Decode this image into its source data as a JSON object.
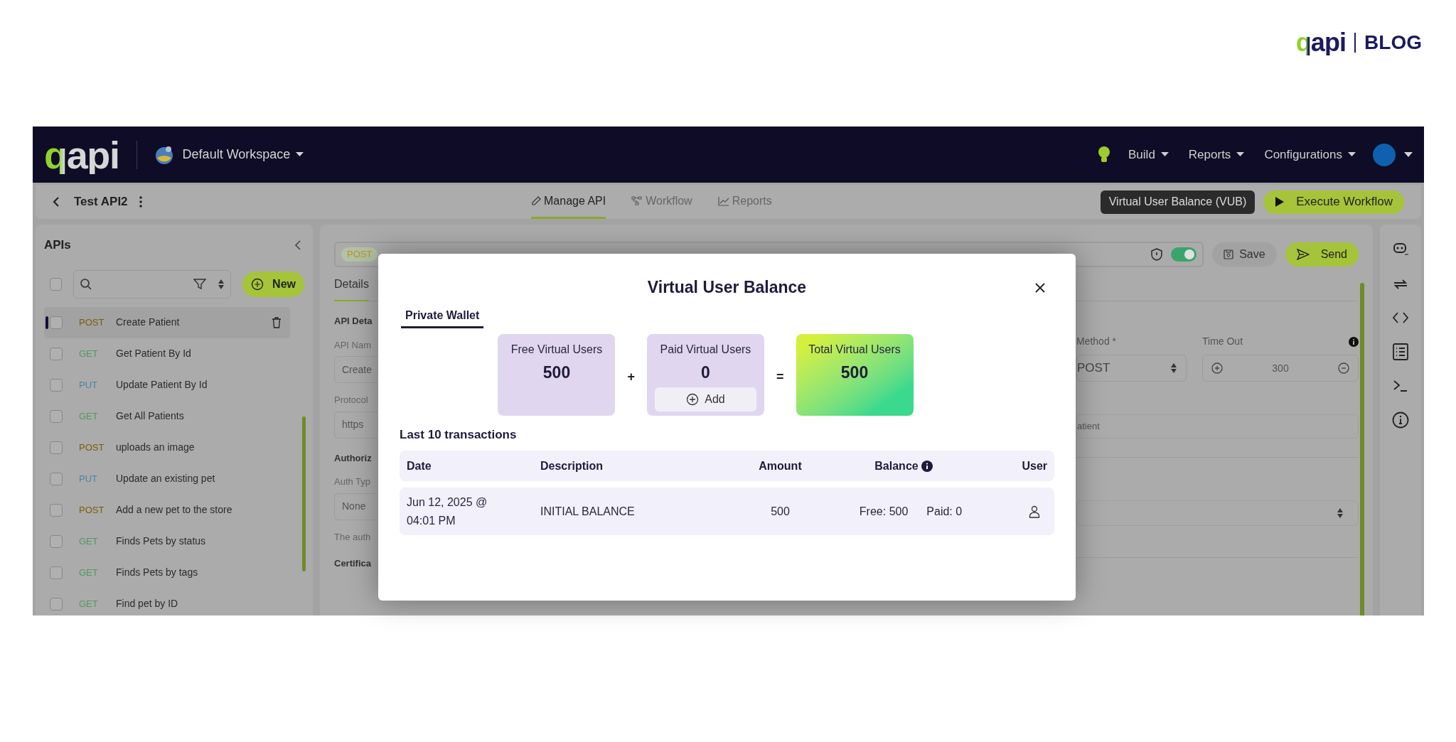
{
  "blog_brand": {
    "logo": "qapi",
    "label": "BLOG"
  },
  "header": {
    "logo": "qapi",
    "workspace": "Default Workspace",
    "menus": [
      "Build",
      "Reports",
      "Configurations"
    ]
  },
  "subheader": {
    "project": "Test API2",
    "tabs": [
      {
        "label": "Manage API",
        "kind": "pencil",
        "selected": true
      },
      {
        "label": "Workflow",
        "kind": "nodes",
        "selected": false
      },
      {
        "label": "Reports",
        "kind": "chart",
        "selected": false
      }
    ],
    "vub_button": "Virtual User Balance (VUB)",
    "execute_button": "Execute Workflow"
  },
  "sidebar": {
    "title": "APIs",
    "select_all": {
      "checked": false
    },
    "new_button": "New",
    "items": [
      {
        "method": "POST",
        "color": "#7a5c08",
        "name": "Create Patient",
        "selected": true,
        "checked": false
      },
      {
        "method": "GET",
        "color": "#4f9a5c",
        "name": "Get Patient By Id",
        "selected": false,
        "checked": false
      },
      {
        "method": "PUT",
        "color": "#4b84a6",
        "name": "Update Patient By Id",
        "selected": false,
        "checked": false
      },
      {
        "method": "GET",
        "color": "#4f9a5c",
        "name": "Get All Patients",
        "selected": false,
        "checked": false
      },
      {
        "method": "POST",
        "color": "#7a5c08",
        "name": "uploads an image",
        "selected": false,
        "checked": false
      },
      {
        "method": "PUT",
        "color": "#4b84a6",
        "name": "Update an existing pet",
        "selected": false,
        "checked": false
      },
      {
        "method": "POST",
        "color": "#7a5c08",
        "name": "Add a new pet to the store",
        "selected": false,
        "checked": false
      },
      {
        "method": "GET",
        "color": "#4f9a5c",
        "name": "Finds Pets by status",
        "selected": false,
        "checked": false
      },
      {
        "method": "GET",
        "color": "#4f9a5c",
        "name": "Finds Pets by tags",
        "selected": false,
        "checked": false
      },
      {
        "method": "GET",
        "color": "#4f9a5c",
        "name": "Find pet by ID",
        "selected": false,
        "checked": false
      }
    ]
  },
  "editor": {
    "method_badge": "POST",
    "secure_toggle": {
      "on": true
    },
    "save_button": "Save",
    "send_button": "Send",
    "tab": "Details",
    "left_fragments": [
      {
        "kind": "heading",
        "text": "API Deta"
      },
      {
        "kind": "label",
        "text": "API Nam"
      },
      {
        "kind": "field",
        "text": "Create"
      },
      {
        "kind": "label",
        "text": "Protocol"
      },
      {
        "kind": "field",
        "text": "https"
      },
      {
        "kind": "heading",
        "text": "Authoriz"
      },
      {
        "kind": "label",
        "text": "Auth Typ"
      },
      {
        "kind": "field",
        "text": "None"
      },
      {
        "kind": "label",
        "text": "The auth"
      },
      {
        "kind": "heading",
        "text": "Certifica"
      }
    ],
    "method_label": "Method *",
    "method_value": "POST",
    "timeout_label": "Time Out",
    "timeout_value": "300",
    "url_fragment": "atient"
  },
  "modal": {
    "title": "Virtual User Balance",
    "tabs": [
      {
        "label": "Private Wallet",
        "selected": true
      }
    ],
    "cards": [
      {
        "kind": "free",
        "label": "Free Virtual Users",
        "value": "500"
      },
      {
        "kind": "paid",
        "label": "Paid Virtual Users",
        "value": "0",
        "button": "Add"
      },
      {
        "kind": "total",
        "label": "Total Virtual Users",
        "value": "500"
      }
    ],
    "operators": [
      "+",
      "="
    ],
    "transactions_title": "Last 10 transactions",
    "columns": [
      "Date",
      "Description",
      "Amount",
      "Balance",
      "User"
    ],
    "rows": [
      {
        "date": "Jun 12, 2025 @ 04:01 PM",
        "description": "INITIAL BALANCE",
        "amount": "500",
        "free": "Free: 500",
        "paid": "Paid: 0"
      }
    ]
  }
}
